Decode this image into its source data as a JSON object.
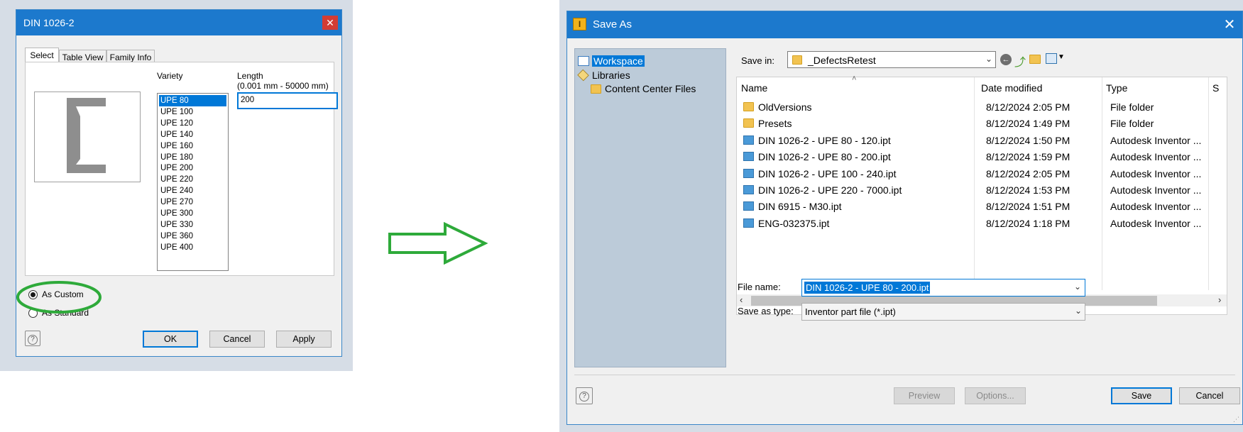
{
  "family_dialog": {
    "title": "DIN 1026-2",
    "close_glyph": "✕",
    "tabs": [
      "Select",
      "Table View",
      "Family Info"
    ],
    "variety_label": "Variety",
    "length_label": "Length",
    "length_range": "(0.001 mm - 50000 mm)",
    "length_value": "200",
    "variety_items": [
      "UPE 80",
      "UPE 100",
      "UPE 120",
      "UPE 140",
      "UPE 160",
      "UPE 180",
      "UPE 200",
      "UPE 220",
      "UPE 240",
      "UPE 270",
      "UPE 300",
      "UPE 330",
      "UPE 360",
      "UPE 400"
    ],
    "variety_selected": "UPE 80",
    "radio_custom": "As Custom",
    "radio_standard": "As Standard",
    "selected_radio": "As Custom",
    "help_glyph": "?",
    "ok_label": "OK",
    "cancel_label": "Cancel",
    "apply_label": "Apply"
  },
  "save_dialog": {
    "title": "Save As",
    "app_icon": "I",
    "close_glyph": "✕",
    "tree": {
      "workspace": "Workspace",
      "libraries": "Libraries",
      "content_center": "Content Center Files"
    },
    "save_in_label": "Save in:",
    "save_in_value": "_DefectsRetest",
    "columns": [
      "Name",
      "Date modified",
      "Type",
      "S"
    ],
    "files": [
      {
        "name": "OldVersions",
        "date": "8/12/2024 2:05 PM",
        "type": "File folder",
        "kind": "folder"
      },
      {
        "name": "Presets",
        "date": "8/12/2024 1:49 PM",
        "type": "File folder",
        "kind": "folder"
      },
      {
        "name": "DIN 1026-2 - UPE 80 - 120.ipt",
        "date": "8/12/2024 1:50 PM",
        "type": "Autodesk Inventor ...",
        "kind": "part"
      },
      {
        "name": "DIN 1026-2 - UPE 80 - 200.ipt",
        "date": "8/12/2024 1:59 PM",
        "type": "Autodesk Inventor ...",
        "kind": "part"
      },
      {
        "name": "DIN 1026-2 - UPE 100 - 240.ipt",
        "date": "8/12/2024 2:05 PM",
        "type": "Autodesk Inventor ...",
        "kind": "part"
      },
      {
        "name": "DIN 1026-2 - UPE 220 - 7000.ipt",
        "date": "8/12/2024 1:53 PM",
        "type": "Autodesk Inventor ...",
        "kind": "part"
      },
      {
        "name": "DIN 6915 - M30.ipt",
        "date": "8/12/2024 1:51 PM",
        "type": "Autodesk Inventor ...",
        "kind": "part"
      },
      {
        "name": "ENG-032375.ipt",
        "date": "8/12/2024 1:18 PM",
        "type": "Autodesk Inventor ...",
        "kind": "part"
      }
    ],
    "file_name_label": "File name:",
    "file_name_value": "DIN 1026-2 - UPE 80 - 200.ipt",
    "save_type_label": "Save as type:",
    "save_type_value": "Inventor part file (*.ipt)",
    "preview_label": "Preview",
    "options_label": "Options...",
    "save_label": "Save",
    "cancel_label": "Cancel",
    "help_glyph": "?"
  },
  "colors": {
    "title_bar": "#1c79cd",
    "selection": "#0078d7",
    "highlight_ellipse": "#2eaa3a",
    "arrow": "#2eaa3a"
  }
}
